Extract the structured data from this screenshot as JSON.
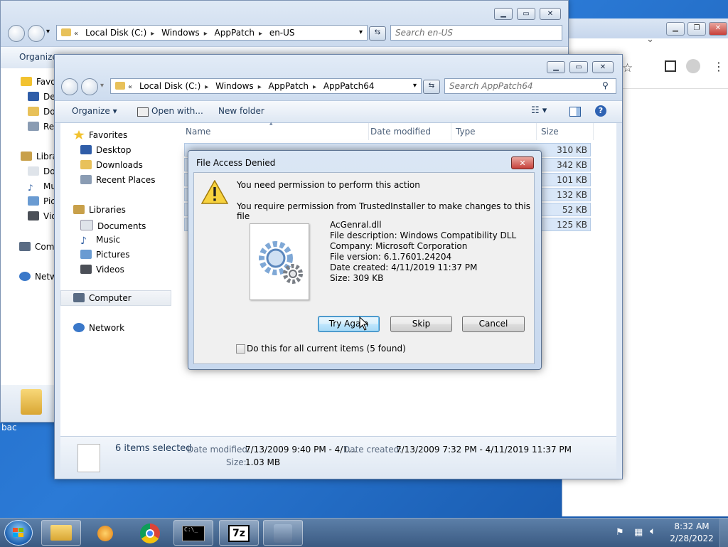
{
  "colors": {
    "dialog_accent": "#3c7fb1",
    "selection": "#d9e7f8",
    "taskbar": "#3a5a82",
    "close_red": "#c7403a"
  },
  "desktop": {
    "partial_label": "bac"
  },
  "chrome": {
    "icons": [
      "chevron-down-icon",
      "star-icon",
      "sidebar-icon",
      "profile-icon",
      "kebab-menu-icon"
    ]
  },
  "back_window": {
    "breadcrumb": [
      "Local Disk (C:)",
      "Windows",
      "AppPatch",
      "en-US"
    ],
    "search_placeholder": "Search en-US",
    "organize": "Organize",
    "nav_items": [
      "Favo",
      "Des",
      "Dov",
      "Rec",
      "Libra",
      "Doc",
      "Mu",
      "Pic",
      "Vid",
      "Com",
      "Netw"
    ]
  },
  "front_window": {
    "breadcrumb_prefix": "«",
    "breadcrumb": [
      "Local Disk (C:)",
      "Windows",
      "AppPatch",
      "AppPatch64"
    ],
    "search_placeholder": "Search AppPatch64",
    "toolbar": {
      "organize": "Organize",
      "open_with": "Open with...",
      "new_folder": "New folder"
    },
    "nav": {
      "favorites": "Favorites",
      "desktop": "Desktop",
      "downloads": "Downloads",
      "recent": "Recent Places",
      "libraries": "Libraries",
      "documents": "Documents",
      "music": "Music",
      "pictures": "Pictures",
      "videos": "Videos",
      "computer": "Computer",
      "network": "Network"
    },
    "columns": {
      "name": "Name",
      "date": "Date modified",
      "type": "Type",
      "size": "Size"
    },
    "file_sizes": [
      "310 KB",
      "342 KB",
      "101 KB",
      "132 KB",
      "52 KB",
      "125 KB"
    ],
    "details": {
      "selected": "6 items selected",
      "date_modified_label": "Date modified:",
      "date_modified_value": "7/13/2009 9:40 PM - 4/1...",
      "date_created_label": "Date created:",
      "date_created_value": "7/13/2009 7:32 PM - 4/11/2019 11:37 PM",
      "size_label": "Size:",
      "size_value": "1.03 MB"
    }
  },
  "dialog": {
    "title": "File Access Denied",
    "close_glyph": "✕",
    "heading": "You need permission to perform this action",
    "message": "You require permission from TrustedInstaller to make changes to this file",
    "file": {
      "name": "AcGenral.dll",
      "description": "File description: Windows Compatibility DLL",
      "company": "Company: Microsoft Corporation",
      "version": "File version: 6.1.7601.24204",
      "created": "Date created: 4/11/2019 11:37 PM",
      "size": "Size: 309 KB"
    },
    "buttons": {
      "try_again": "Try Again",
      "skip": "Skip",
      "cancel": "Cancel"
    },
    "checkbox_label": "Do this for all current items (5 found)"
  },
  "taskbar": {
    "items": [
      "windows-explorer-icon",
      "media-player-icon",
      "chrome-icon",
      "command-prompt-icon",
      "7zip-icon",
      "network-setup-icon"
    ],
    "app_7zip_label": "7z",
    "cmd_label": "C:\\_",
    "time": "8:32 AM",
    "date": "2/28/2022"
  }
}
